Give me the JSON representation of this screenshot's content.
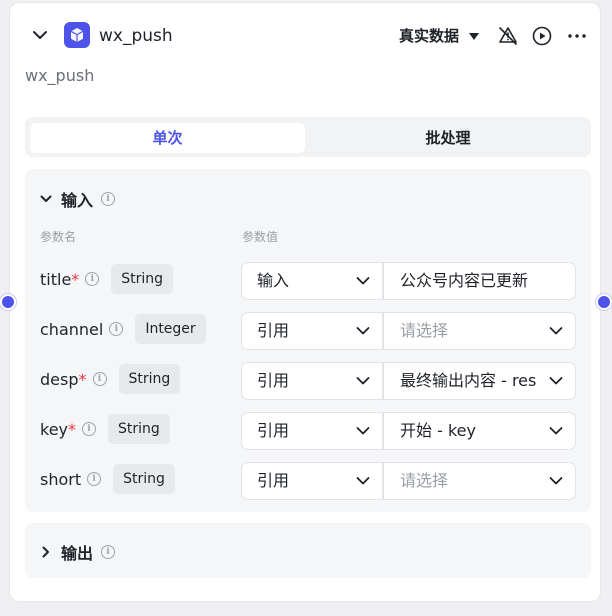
{
  "node": {
    "title": "wx_push",
    "description": "wx_push",
    "data_mode": "真实数据",
    "accent": "#4d53e8"
  },
  "tabs": [
    {
      "label": "单次",
      "active": true
    },
    {
      "label": "批处理",
      "active": false
    }
  ],
  "input_section": {
    "title": "输入",
    "col_name": "参数名",
    "col_value": "参数值",
    "params": [
      {
        "name": "title",
        "required": true,
        "type": "String",
        "mode": "输入",
        "value": "公众号内容已更新",
        "placeholder": false
      },
      {
        "name": "channel",
        "required": false,
        "type": "Integer",
        "mode": "引用",
        "value": "请选择",
        "placeholder": true
      },
      {
        "name": "desp",
        "required": true,
        "type": "String",
        "mode": "引用",
        "value": "最终输出内容 - res",
        "placeholder": false
      },
      {
        "name": "key",
        "required": true,
        "type": "String",
        "mode": "引用",
        "value": "开始 - key",
        "placeholder": false
      },
      {
        "name": "short",
        "required": false,
        "type": "String",
        "mode": "引用",
        "value": "请选择",
        "placeholder": true
      }
    ]
  },
  "output_section": {
    "title": "输出"
  },
  "icons": {
    "node": "cube-icon",
    "collapse": "chevron-down-icon",
    "warning": "bell-off-icon",
    "run": "play-circle-icon",
    "more": "more-dots-icon",
    "info": "info-icon"
  }
}
